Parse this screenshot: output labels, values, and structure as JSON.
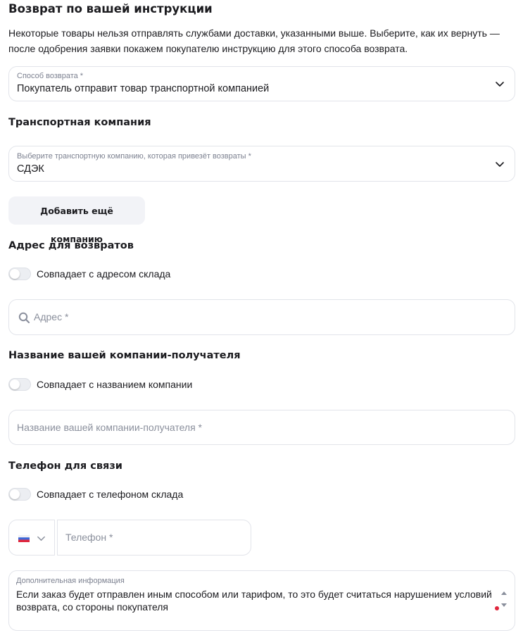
{
  "header": {
    "title": "Возврат по вашей инструкции",
    "description": "Некоторые товары нельзя отправлять службами доставки, указанными выше. Выберите, как их вернуть — после одобрения заявки покажем покупателю инструкцию для этого способа возврата."
  },
  "return_method": {
    "label": "Способ возврата *",
    "value": "Покупатель отправит товар транспортной компанией"
  },
  "transport": {
    "section_title": "Транспортная компания",
    "label": "Выберите транспортную компанию, которая привезёт возвраты *",
    "value": "СДЭК",
    "add_button": "Добавить ещё компанию"
  },
  "address": {
    "section_title": "Адрес для возвратов",
    "toggle_label": "Совпадает с адресом склада",
    "toggle_on": false,
    "placeholder": "Адрес *"
  },
  "company": {
    "section_title": "Название вашей компании-получателя",
    "toggle_label": "Совпадает с названием компании",
    "toggle_on": false,
    "placeholder": "Название вашей компании-получателя *"
  },
  "phone": {
    "section_title": "Телефон для связи",
    "toggle_label": "Совпадает с телефоном склада",
    "toggle_on": false,
    "country_flag": "russia-flag-icon",
    "placeholder": "Телефон *"
  },
  "extra_info": {
    "label": "Дополнительная информация",
    "value": "Если заказ будет отправлен иным способом или тарифом, то это будет считаться нарушением условий возврата, со стороны покупателя"
  },
  "colors": {
    "border": "#e2e4ea",
    "button_bg": "#f2f3f7",
    "muted_text": "#7c8190",
    "error_dot": "#e0263c"
  }
}
